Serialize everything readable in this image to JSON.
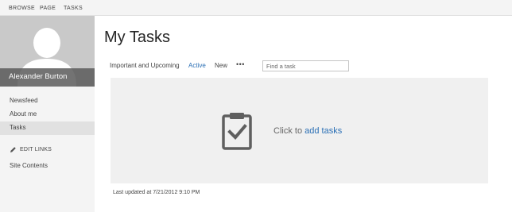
{
  "ribbon": {
    "tabs": [
      "BROWSE",
      "PAGE",
      "TASKS"
    ]
  },
  "profile": {
    "name": "Alexander Burton"
  },
  "nav": {
    "items": [
      {
        "label": "Newsfeed",
        "selected": false
      },
      {
        "label": "About me",
        "selected": false
      },
      {
        "label": "Tasks",
        "selected": true
      }
    ],
    "edit_links": "EDIT LINKS",
    "site_contents": "Site Contents"
  },
  "main": {
    "title": "My Tasks",
    "views": [
      {
        "label": "Important and Upcoming",
        "active": false
      },
      {
        "label": "Active",
        "active": true
      },
      {
        "label": "New",
        "active": false
      }
    ],
    "more": "•••",
    "search_placeholder": "Find a task",
    "empty_prefix": "Click to ",
    "empty_link": "add tasks",
    "last_updated": "Last updated at 7/21/2012 9:10 PM"
  },
  "colors": {
    "accent": "#2a6fb5",
    "sidebar_bg": "#f4f4f4",
    "selected_bg": "#e1e1e1",
    "panel_bg": "#f0f0f0"
  },
  "icons": {
    "clipboard": "clipboard-check-icon",
    "pencil": "pencil-icon",
    "avatar": "person-silhouette-icon"
  }
}
